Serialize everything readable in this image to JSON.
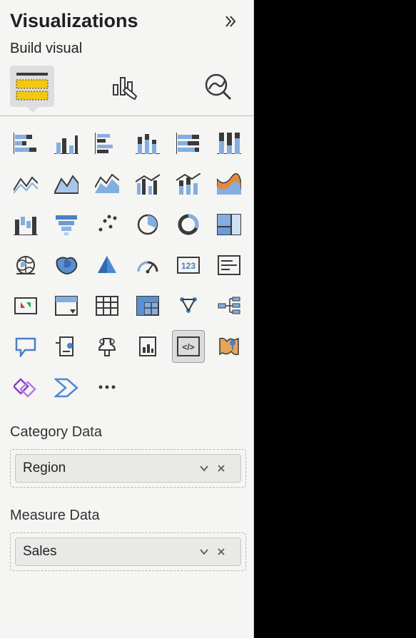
{
  "pane": {
    "title": "Visualizations",
    "subtitle": "Build visual"
  },
  "tabs": [
    {
      "id": "build",
      "label": "Build visual",
      "active": true
    },
    {
      "id": "format",
      "label": "Format visual",
      "active": false
    },
    {
      "id": "analytics",
      "label": "Analytics",
      "active": false
    }
  ],
  "chart_icons": [
    {
      "name": "stacked-bar-chart-icon"
    },
    {
      "name": "clustered-bar-chart-icon"
    },
    {
      "name": "stacked-column-chart-icon"
    },
    {
      "name": "clustered-column-chart-icon"
    },
    {
      "name": "100-stacked-bar-icon"
    },
    {
      "name": "100-stacked-column-icon"
    },
    {
      "name": "line-chart-icon"
    },
    {
      "name": "area-chart-icon"
    },
    {
      "name": "stacked-area-chart-icon"
    },
    {
      "name": "line-clustered-column-icon"
    },
    {
      "name": "line-stacked-column-icon"
    },
    {
      "name": "ribbon-chart-icon"
    },
    {
      "name": "waterfall-chart-icon"
    },
    {
      "name": "funnel-chart-icon"
    },
    {
      "name": "scatter-chart-icon"
    },
    {
      "name": "pie-chart-icon"
    },
    {
      "name": "donut-chart-icon"
    },
    {
      "name": "treemap-chart-icon"
    },
    {
      "name": "map-icon"
    },
    {
      "name": "filled-map-icon"
    },
    {
      "name": "azure-map-icon"
    },
    {
      "name": "gauge-icon"
    },
    {
      "name": "card-icon"
    },
    {
      "name": "multi-row-card-icon"
    },
    {
      "name": "kpi-icon"
    },
    {
      "name": "slicer-icon"
    },
    {
      "name": "table-icon"
    },
    {
      "name": "matrix-icon"
    },
    {
      "name": "r-visual-icon"
    },
    {
      "name": "decomposition-tree-icon"
    },
    {
      "name": "qa-visual-icon"
    },
    {
      "name": "smart-narrative-icon"
    },
    {
      "name": "key-influencers-icon"
    },
    {
      "name": "paginated-report-icon"
    },
    {
      "name": "python-visual-icon",
      "selected": true
    },
    {
      "name": "arcgis-map-icon"
    },
    {
      "name": "power-apps-icon"
    },
    {
      "name": "power-automate-icon"
    },
    {
      "name": "more-visuals-icon"
    }
  ],
  "fields": {
    "category": {
      "title": "Category Data",
      "items": [
        {
          "label": "Region"
        }
      ]
    },
    "measure": {
      "title": "Measure Data",
      "items": [
        {
          "label": "Sales"
        }
      ]
    }
  }
}
